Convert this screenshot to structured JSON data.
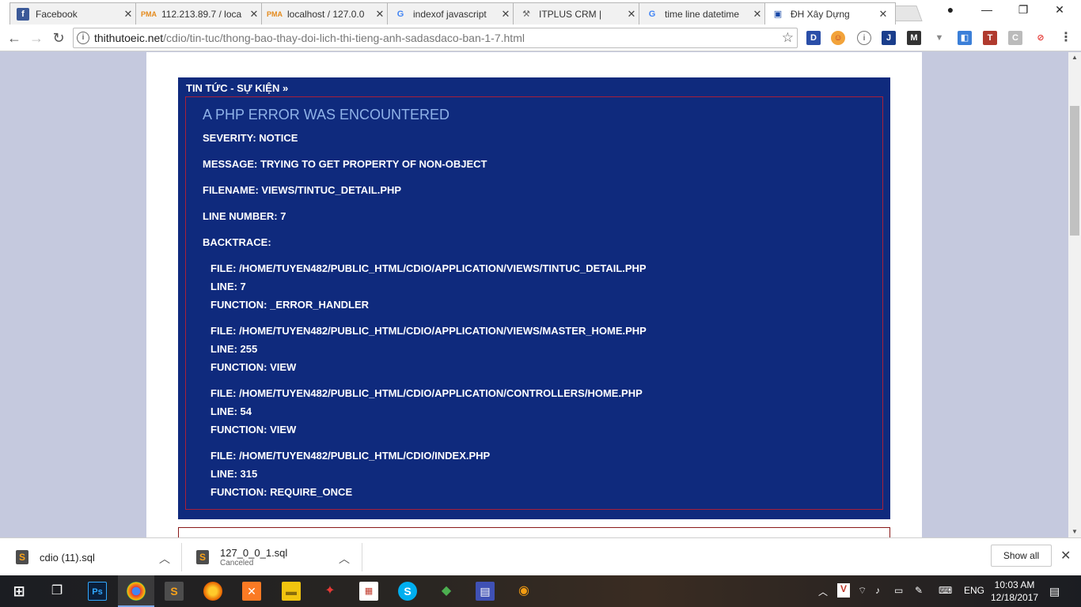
{
  "tabs": [
    {
      "title": "Facebook",
      "icon": "facebook-icon",
      "active": false
    },
    {
      "title": "112.213.89.7 / loca",
      "icon": "phpmyadmin-icon",
      "active": false
    },
    {
      "title": "localhost / 127.0.0",
      "icon": "phpmyadmin-icon",
      "active": false
    },
    {
      "title": "indexof javascript",
      "icon": "google-icon",
      "active": false
    },
    {
      "title": "ITPLUS CRM |",
      "icon": "tools-icon",
      "active": false
    },
    {
      "title": "time line datetime",
      "icon": "google-icon",
      "active": false
    },
    {
      "title": "ĐH Xây Dựng",
      "icon": "university-icon",
      "active": true
    }
  ],
  "address_bar": {
    "host": "thithutoeic.net",
    "path": "/cdio/tin-tuc/thong-bao-thay-doi-lich-thi-tieng-anh-sadasdaco-ban-1-7.html"
  },
  "news": {
    "header": "TIN TỨC - SỰ KIỆN »",
    "error_title": "A PHP Error was encountered",
    "severity": "Severity: Notice",
    "message": "Message: Trying to get property of non-object",
    "filename": "Filename: views/tintuc_detail.php",
    "line_number": "Line Number: 7",
    "backtrace_label": "Backtrace:",
    "backtrace": [
      {
        "file": "File: /home/tuyen482/public_html/cdio/application/views/tintuc_detail.php",
        "line": "Line: 7",
        "function": "Function: _error_handler"
      },
      {
        "file": "File: /home/tuyen482/public_html/cdio/application/views/master_home.php",
        "line": "Line: 255",
        "function": "Function: view"
      },
      {
        "file": "File: /home/tuyen482/public_html/cdio/application/controllers/Home.php",
        "line": "Line: 54",
        "function": "Function: view"
      },
      {
        "file": "File: /home/tuyen482/public_html/cdio/index.php",
        "line": "Line: 315",
        "function": "Function: require_once"
      }
    ]
  },
  "downloads": [
    {
      "name": "cdio (11).sql",
      "status": ""
    },
    {
      "name": "127_0_0_1.sql",
      "status": "Canceled"
    }
  ],
  "download_shelf": {
    "show_all": "Show all"
  },
  "taskbar": {
    "language": "ENG",
    "time": "10:03 AM",
    "date": "12/18/2017"
  },
  "colors": {
    "news_background": "#0f2a7d",
    "error_title": "#8fb2e8",
    "error_border": "#a8203a",
    "page_side_background": "#c5c9de"
  }
}
